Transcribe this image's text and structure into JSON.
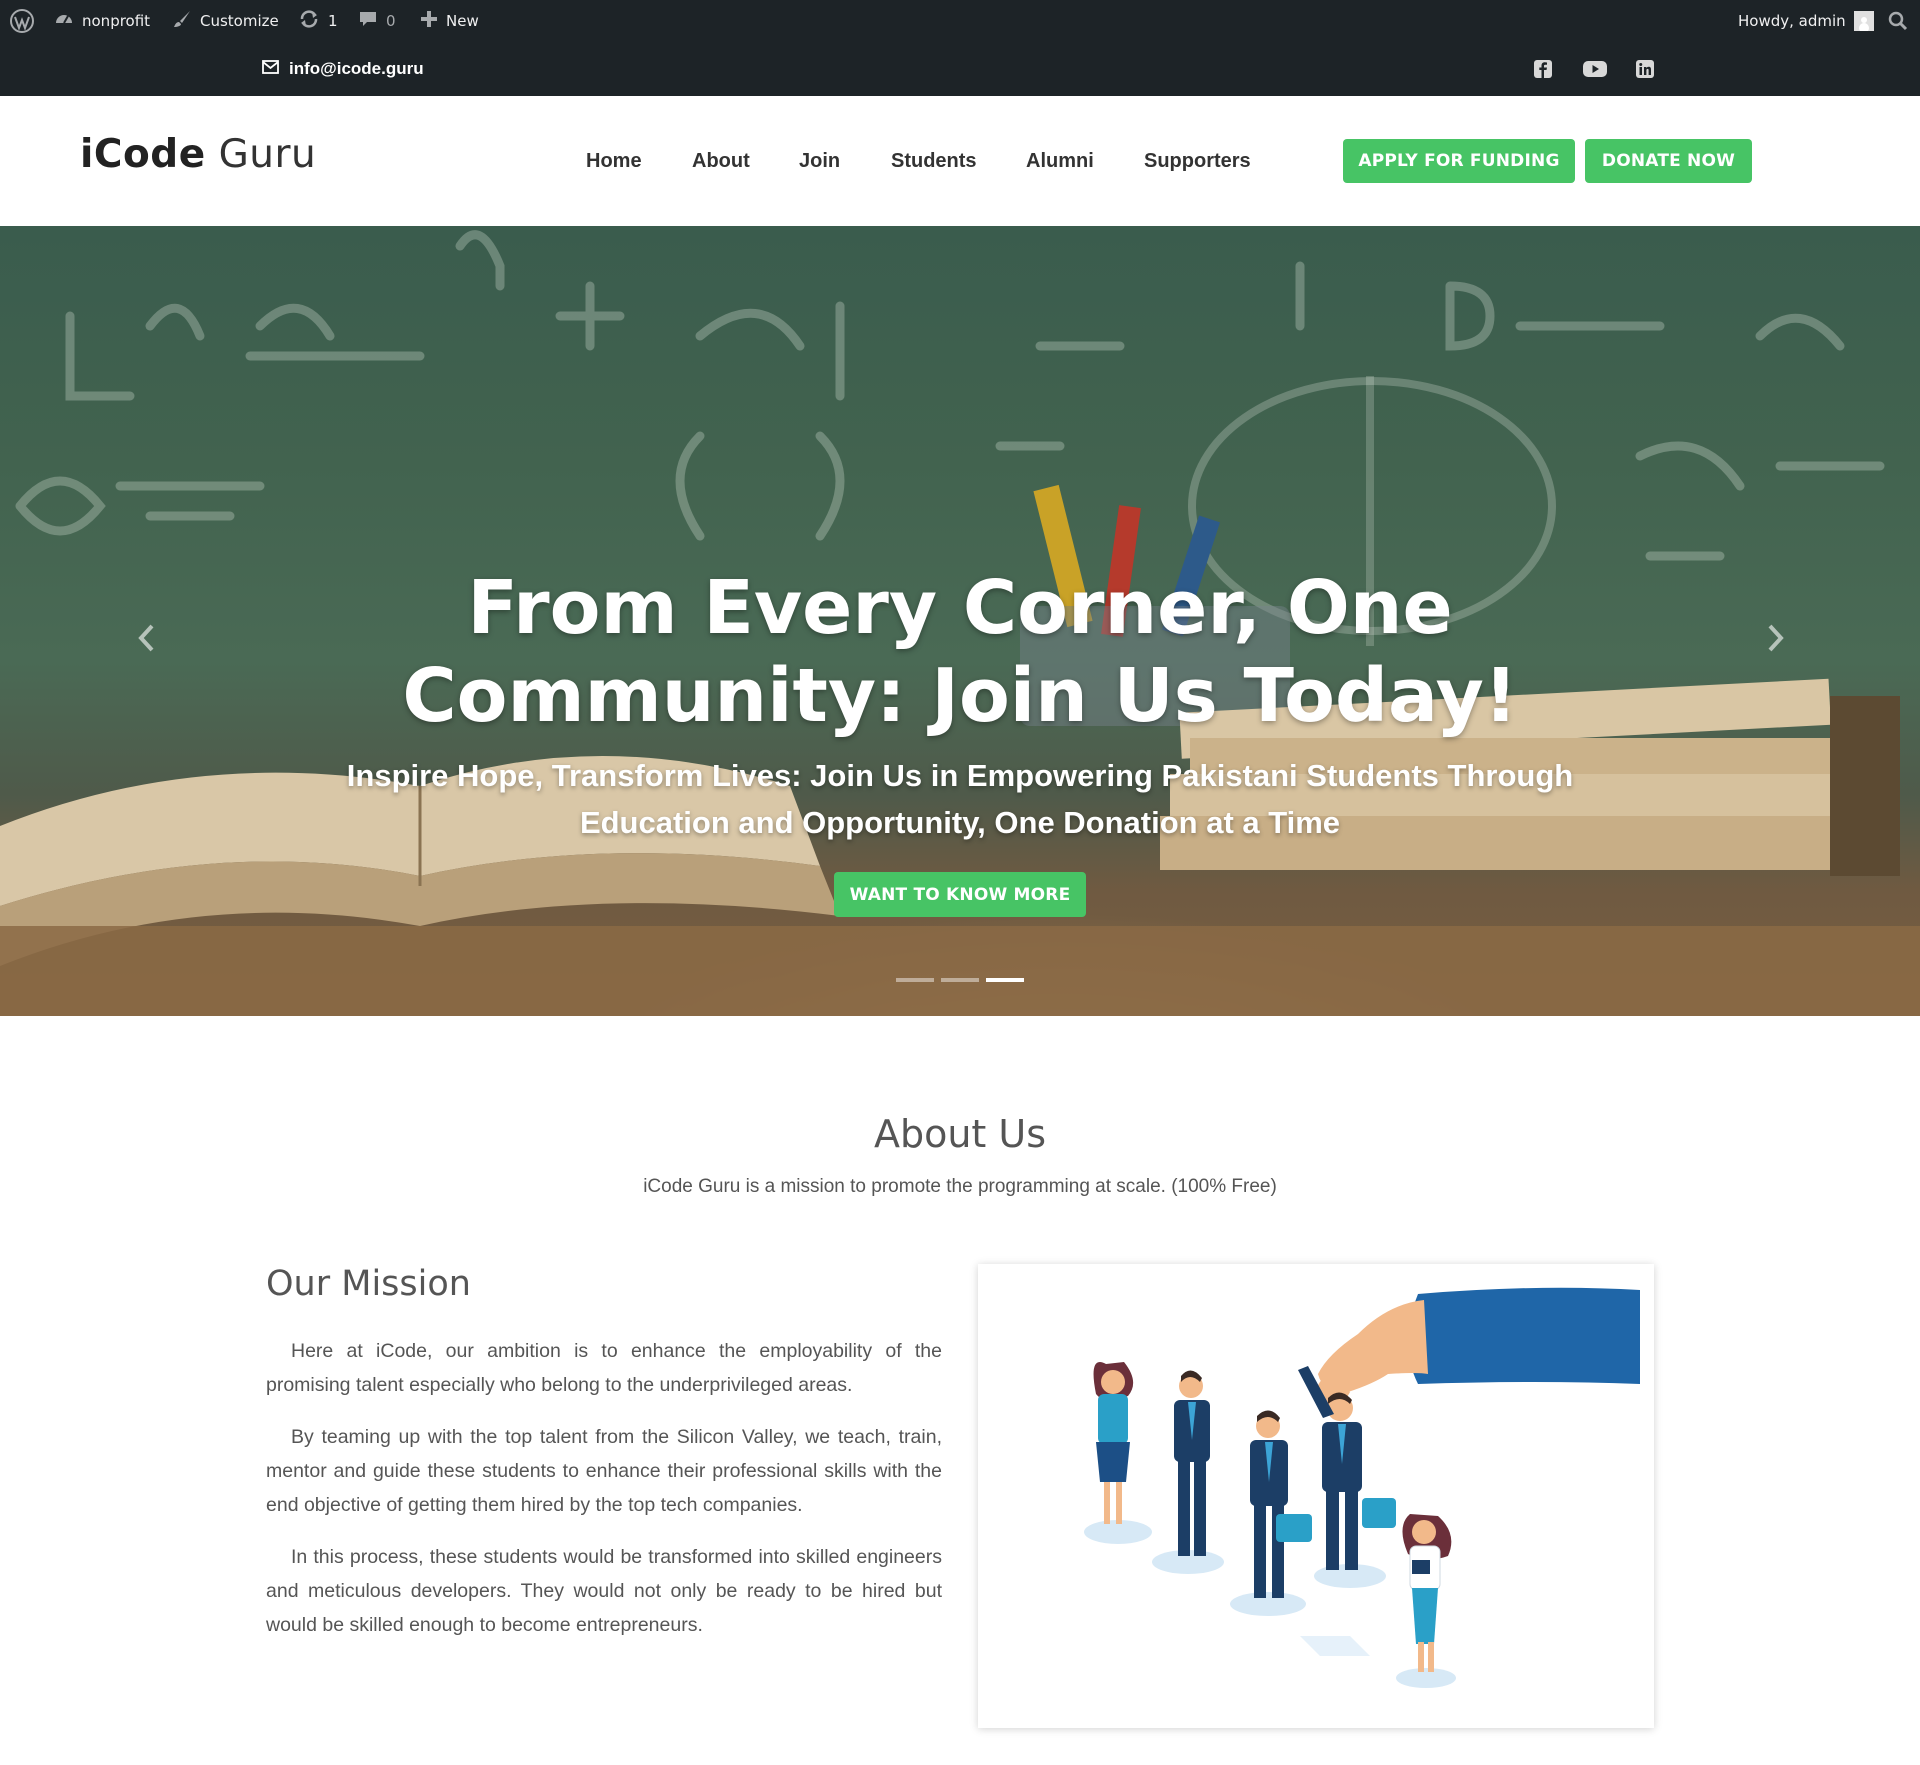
{
  "admin_bar": {
    "site_name": "nonprofit",
    "customize": "Customize",
    "updates_count": "1",
    "comments_count": "0",
    "new_label": "New",
    "greeting": "Howdy, admin"
  },
  "contact_bar": {
    "email": "info@icode.guru",
    "social": [
      "facebook-icon",
      "youtube-icon",
      "linkedin-icon"
    ]
  },
  "header": {
    "logo_bold": "iCode",
    "logo_light": "Guru",
    "nav": [
      "Home",
      "About",
      "Join",
      "Students",
      "Alumni",
      "Supporters"
    ],
    "apply_button": "APPLY FOR FUNDING",
    "donate_button": "DONATE NOW"
  },
  "hero": {
    "title_line1": "From Every Corner, One",
    "title_line2": "Community: Join Us Today!",
    "subtitle_line1": "Inspire Hope, Transform Lives: Join Us in Empowering Pakistani Students Through",
    "subtitle_line2": "Education and Opportunity, One Donation at a Time",
    "cta": "WANT TO KNOW MORE",
    "slide_count": 3,
    "active_slide": 3
  },
  "about": {
    "title": "About Us",
    "subtitle": "iCode Guru is a mission to promote the programming at scale. (100% Free)",
    "mission_title": "Our Mission",
    "paragraphs": [
      "Here at iCode, our ambition is to enhance the employability of the promising talent especially who belong to the underprivileged areas.",
      "By teaming up with the top talent from the Silicon Valley, we teach, train, mentor and guide these students to enhance their professional skills with the end objective of getting them hired by the top tech companies.",
      "In this process, these students would be transformed into skilled engineers and meticulous developers. They would not only be ready to be hired but would be skilled enough to become entrepreneurs."
    ]
  },
  "colors": {
    "admin_bar": "#1d2327",
    "accent_green": "#47c465",
    "text": "#555555"
  }
}
